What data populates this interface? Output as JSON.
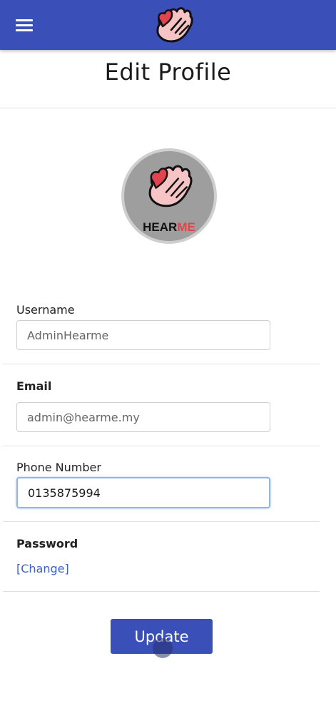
{
  "app_bar": {
    "menu_icon": "hamburger-menu-icon",
    "logo_icon": "hearme-hand-heart-logo",
    "color": "#3a4fb8"
  },
  "page": {
    "title": "Edit Profile"
  },
  "avatar": {
    "logo_text_part1": "HEAR",
    "logo_text_part2": "ME"
  },
  "form": {
    "username": {
      "label": "Username",
      "value": "AdminHearme"
    },
    "email": {
      "label": "Email",
      "value": "admin@hearme.my"
    },
    "phone": {
      "label": "Phone Number",
      "value": "0135875994"
    },
    "password": {
      "label": "Password",
      "change_link": "[Change]"
    },
    "update_button": "Update"
  },
  "colors": {
    "primary": "#3a4fb8",
    "link": "#3a63c9",
    "logo_red": "#e0444e",
    "logo_pink": "#f6c4c4"
  }
}
